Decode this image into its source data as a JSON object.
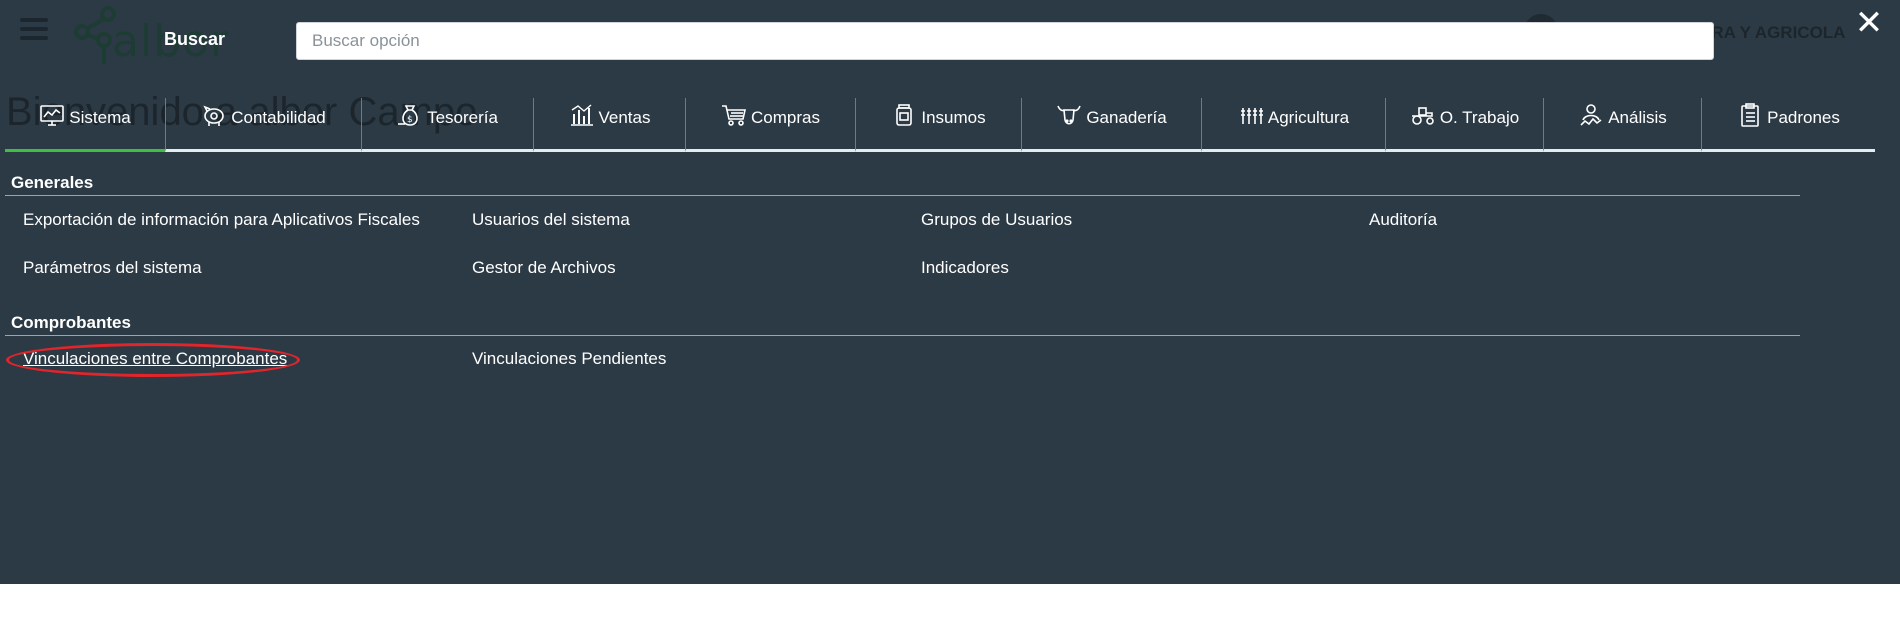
{
  "background": {
    "logo_text": "albor",
    "welcome_text": "Bienvenido a albor Campo",
    "company_text": "ERA Y AGRICOLA"
  },
  "search": {
    "label": "Buscar",
    "placeholder": "Buscar opción",
    "value": ""
  },
  "close_icon": "✕",
  "tabs": [
    {
      "label": "Sistema",
      "icon": "monitor-chart-icon",
      "active": true
    },
    {
      "label": "Contabilidad",
      "icon": "piggy-bank-icon",
      "active": false
    },
    {
      "label": "Tesorería",
      "icon": "money-bag-icon",
      "active": false
    },
    {
      "label": "Ventas",
      "icon": "bar-chart-icon",
      "active": false
    },
    {
      "label": "Compras",
      "icon": "shopping-cart-icon",
      "active": false
    },
    {
      "label": "Insumos",
      "icon": "jar-icon",
      "active": false
    },
    {
      "label": "Ganadería",
      "icon": "cow-head-icon",
      "active": false
    },
    {
      "label": "Agricultura",
      "icon": "crops-icon",
      "active": false
    },
    {
      "label": "O. Trabajo",
      "icon": "tractor-icon",
      "active": false
    },
    {
      "label": "Análisis",
      "icon": "analyst-icon",
      "active": false
    },
    {
      "label": "Padrones",
      "icon": "clipboard-icon",
      "active": false
    }
  ],
  "sections": {
    "generales": {
      "title": "Generales",
      "items": [
        "Exportación de información para Aplicativos Fiscales",
        "Usuarios del sistema",
        "Grupos de Usuarios",
        "Auditoría",
        "Parámetros del sistema",
        "Gestor de Archivos",
        "Indicadores"
      ]
    },
    "comprobantes": {
      "title": "Comprobantes",
      "items": [
        "Vinculaciones entre Comprobantes",
        "Vinculaciones Pendientes"
      ]
    }
  },
  "colors": {
    "overlay": "#2c3a45",
    "active_tab_underline": "#3fbf3f",
    "highlight": "#e0252b",
    "text": "#ffffff"
  }
}
